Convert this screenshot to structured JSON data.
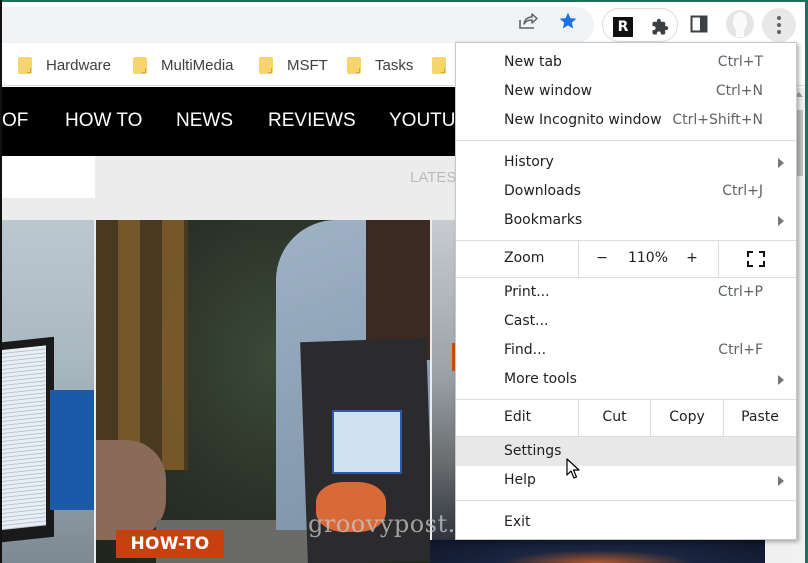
{
  "browser": {
    "address_bar": {
      "value": ""
    },
    "toolbar_icons": [
      "share-icon",
      "bookmark-star-icon",
      "r-extension-icon",
      "extensions-puzzle-icon",
      "side-panel-icon",
      "profile-avatar-icon",
      "more-menu-icon"
    ],
    "extension_letter": "R",
    "accent_color": "#1a73e8"
  },
  "bookmarks": [
    {
      "label": "Hardware"
    },
    {
      "label": "MultiMedia"
    },
    {
      "label": "MSFT"
    },
    {
      "label": "Tasks"
    },
    {
      "label": ""
    }
  ],
  "site": {
    "nav": [
      "OF",
      "HOW TO",
      "NEWS",
      "REVIEWS",
      "YOUTUBE"
    ],
    "subbar_label": "LATES",
    "badge": "HOW-TO",
    "badge_color": "#c6410e",
    "watermark": "groovypost.com"
  },
  "menu": {
    "items": [
      {
        "label": "New tab",
        "shortcut": "Ctrl+T"
      },
      {
        "label": "New window",
        "shortcut": "Ctrl+N"
      },
      {
        "label": "New Incognito window",
        "shortcut": "Ctrl+Shift+N"
      },
      {
        "label": "History",
        "shortcut": "",
        "submenu": true
      },
      {
        "label": "Downloads",
        "shortcut": "Ctrl+J"
      },
      {
        "label": "Bookmarks",
        "shortcut": "",
        "submenu": true
      },
      {
        "label": "Print...",
        "shortcut": "Ctrl+P"
      },
      {
        "label": "Cast...",
        "shortcut": ""
      },
      {
        "label": "Find...",
        "shortcut": "Ctrl+F"
      },
      {
        "label": "More tools",
        "shortcut": "",
        "submenu": true
      },
      {
        "label": "Settings",
        "shortcut": "",
        "hovered": true
      },
      {
        "label": "Help",
        "shortcut": "",
        "submenu": true
      },
      {
        "label": "Exit",
        "shortcut": ""
      }
    ],
    "zoom": {
      "label": "Zoom",
      "minus": "−",
      "value": "110%",
      "plus": "+"
    },
    "edit": {
      "label": "Edit",
      "cut": "Cut",
      "copy": "Copy",
      "paste": "Paste"
    }
  }
}
